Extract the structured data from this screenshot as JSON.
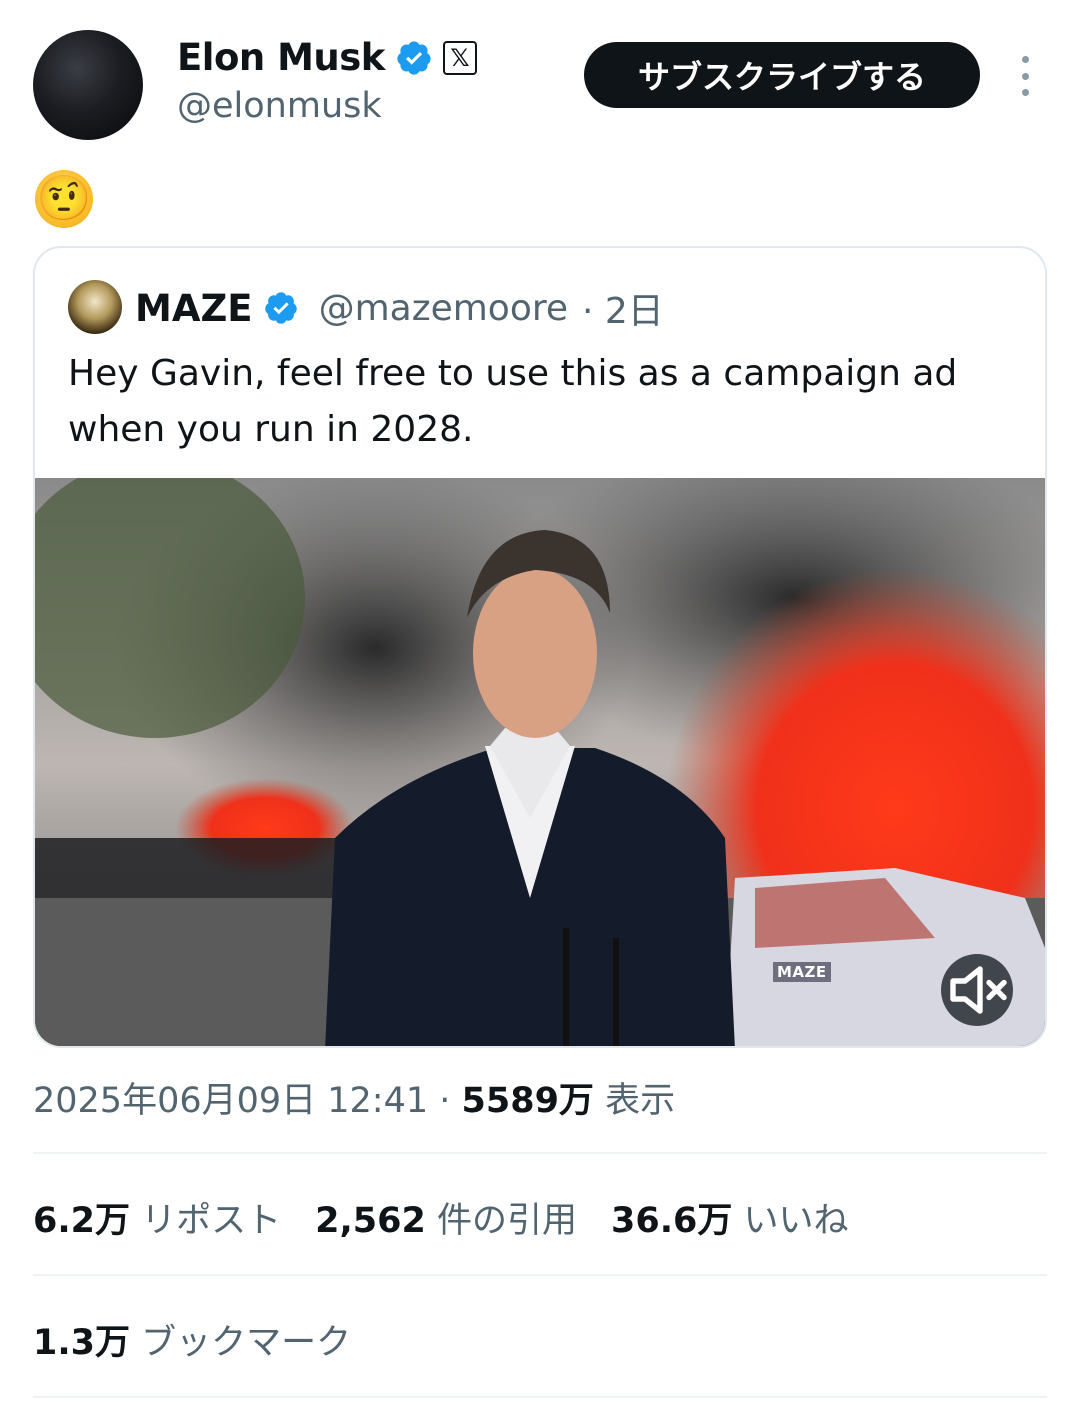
{
  "author": {
    "name": "Elon Musk",
    "handle": "@elonmusk",
    "subscribe_label": "サブスクライブする",
    "avatar_icon": "profile-avatar",
    "verified_icon": "verified-badge-icon",
    "affiliate_icon": "x-logo-icon"
  },
  "post": {
    "text": "🤨"
  },
  "quoted_post": {
    "name": "MAZE",
    "handle": "@mazemoore",
    "time": "· 2日",
    "text": "Hey Gavin, feel free to use this as a campaign ad when you run in 2028.",
    "media_watermark": "MAZE",
    "mute_icon": "speaker-muted-icon"
  },
  "meta": {
    "timestamp": "2025年06月09日 12:41 · ",
    "views_count": "5589万",
    "views_label": " 表示"
  },
  "stats": {
    "reposts_count": "6.2万",
    "reposts_label": " リポスト",
    "quotes_count": "2,562",
    "quotes_label": " 件の引用",
    "likes_count": "36.6万",
    "likes_label": " いいね",
    "bookmarks_count": "1.3万",
    "bookmarks_label": " ブックマーク"
  },
  "colors": {
    "text_primary": "#0f1419",
    "text_secondary": "#536471",
    "verified_blue": "#1d9bf0",
    "button_bg": "#0f1419",
    "border": "#e1e8ed"
  }
}
